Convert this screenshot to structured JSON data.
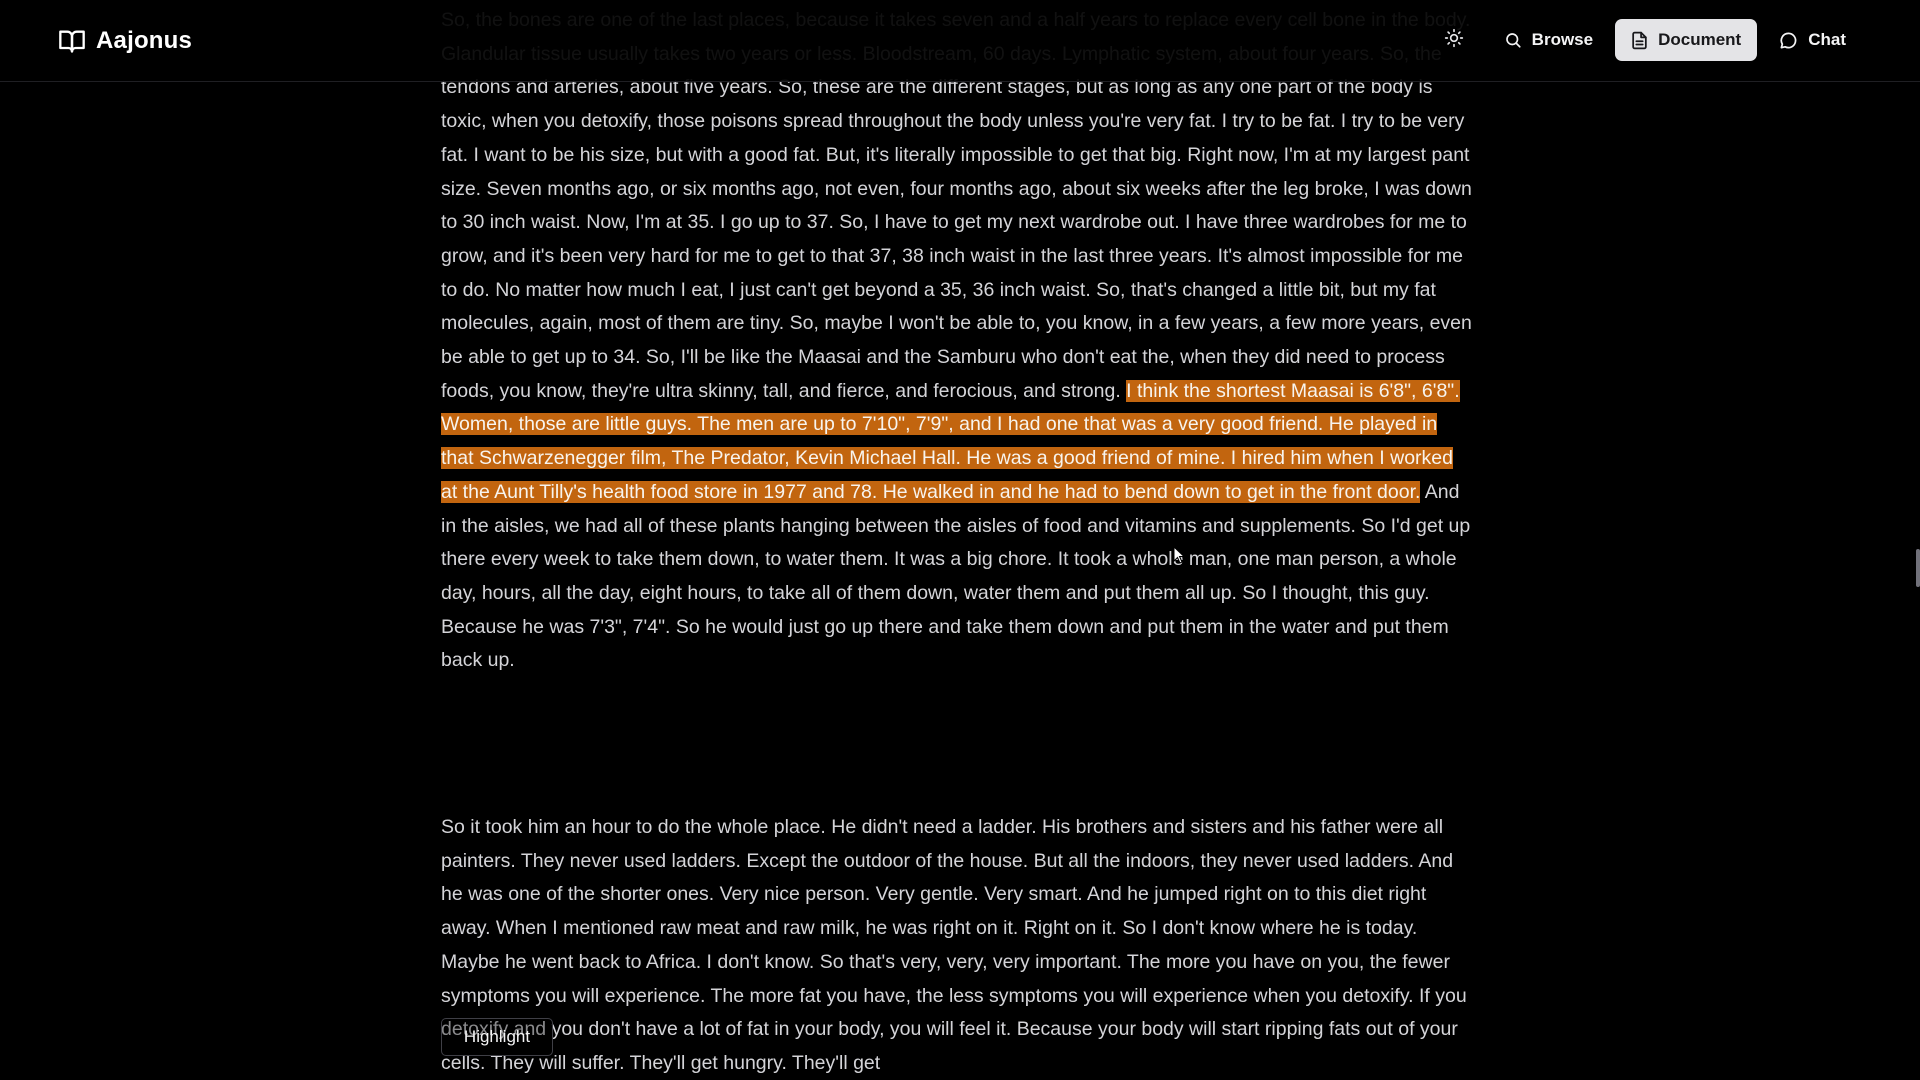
{
  "header": {
    "app_name": "Aajonus",
    "brand_icon": "open-book-icon",
    "theme_toggle_icon": "sun-icon",
    "nav": [
      {
        "label": "Browse",
        "icon": "search-icon",
        "active": false
      },
      {
        "label": "Document",
        "icon": "document-icon",
        "active": true
      },
      {
        "label": "Chat",
        "icon": "chat-bubble-icon",
        "active": false
      }
    ]
  },
  "document": {
    "paragraph_1": {
      "before_highlight": "So, the bones are one of the last places, because it takes seven and a half years to replace every cell bone in the body. Glandular tissue usually takes two years or less. Bloodstream, 60 days. Lymphatic system, about four years. So, the tendons and arteries, about five years. So, these are the different stages, but as long as any one part of the body is toxic, when you detoxify, those poisons spread throughout the body unless you're very fat. I try to be fat. I try to be very fat. I want to be his size, but with a good fat. But, it's literally impossible to get that big. Right now, I'm at my largest pant size. Seven months ago, or six months ago, not even, four months ago, about six weeks after the leg broke, I was down to 30 inch waist. Now, I'm at 35. I go up to 37. So, I have to get my next wardrobe out. I have three wardrobes for me to grow, and it's been very hard for me to get to that 37, 38 inch waist in the last three years. It's almost impossible for me to do. No matter how much I eat, I just can't get beyond a 35, 36 inch waist. So, that's changed a little bit, but my fat molecules, again, most of them are tiny. So, maybe I won't be able to, you know, in a few years, a few more years, even be able to get up to 34. So, I'll be like the Maasai and the Samburu who don't eat the, when they did need to process foods, you know, they're ultra skinny, tall, and fierce, and ferocious, and strong. ",
      "highlighted": "I think the shortest Maasai is 6'8\", 6'8\". Women, those are little guys. The men are up to 7'10\", 7'9\", and I had one that was a very good friend. He played in that Schwarzenegger film, The Predator, Kevin Michael Hall. He was a good friend of mine. I hired him when I worked at the Aunt Tilly's health food store in 1977 and 78. He walked in and he had to bend down to get in the front door.",
      "after_highlight": " And in the aisles, we had all of these plants hanging between the aisles of food and vitamins and supplements. So I'd get up there every week to take them down, to water them. It was a big chore. It took a whole man, one man person, a whole day, hours, all the day, eight hours, to take all of them down, water them and put them all up. So I thought, this guy. Because he was 7'3\", 7'4\". So he would just go up there and take them down and put them in the water and put them back up."
    },
    "paragraph_2": "So it took him an hour to do the whole place. He didn't need a ladder. His brothers and sisters and his father were all painters. They never used ladders. Except the outdoor of the house. But all the indoors, they never used ladders. And he was one of the shorter ones. Very nice person. Very gentle. Very smart. And he jumped right on to this diet right away. When I mentioned raw meat and raw milk, he was right on it. Right on it. So I don't know where he is today. Maybe he went back to Africa. I don't know. So that's very, very, very important. The more you have on you, the fewer symptoms you will experience. The more fat you have, the less symptoms you will experience when you detoxify. If you detoxify and you don't have a lot of fat in your body, you will feel it. Because your body will start ripping fats out of your cells. They will suffer. They'll get hungry. They'll get"
  },
  "selection_popup": {
    "label": "Highlight"
  },
  "colors": {
    "background": "#000000",
    "text": "#d4d4d8",
    "highlight": "#c2650f",
    "active_nav_bg": "#e4e4e7"
  }
}
